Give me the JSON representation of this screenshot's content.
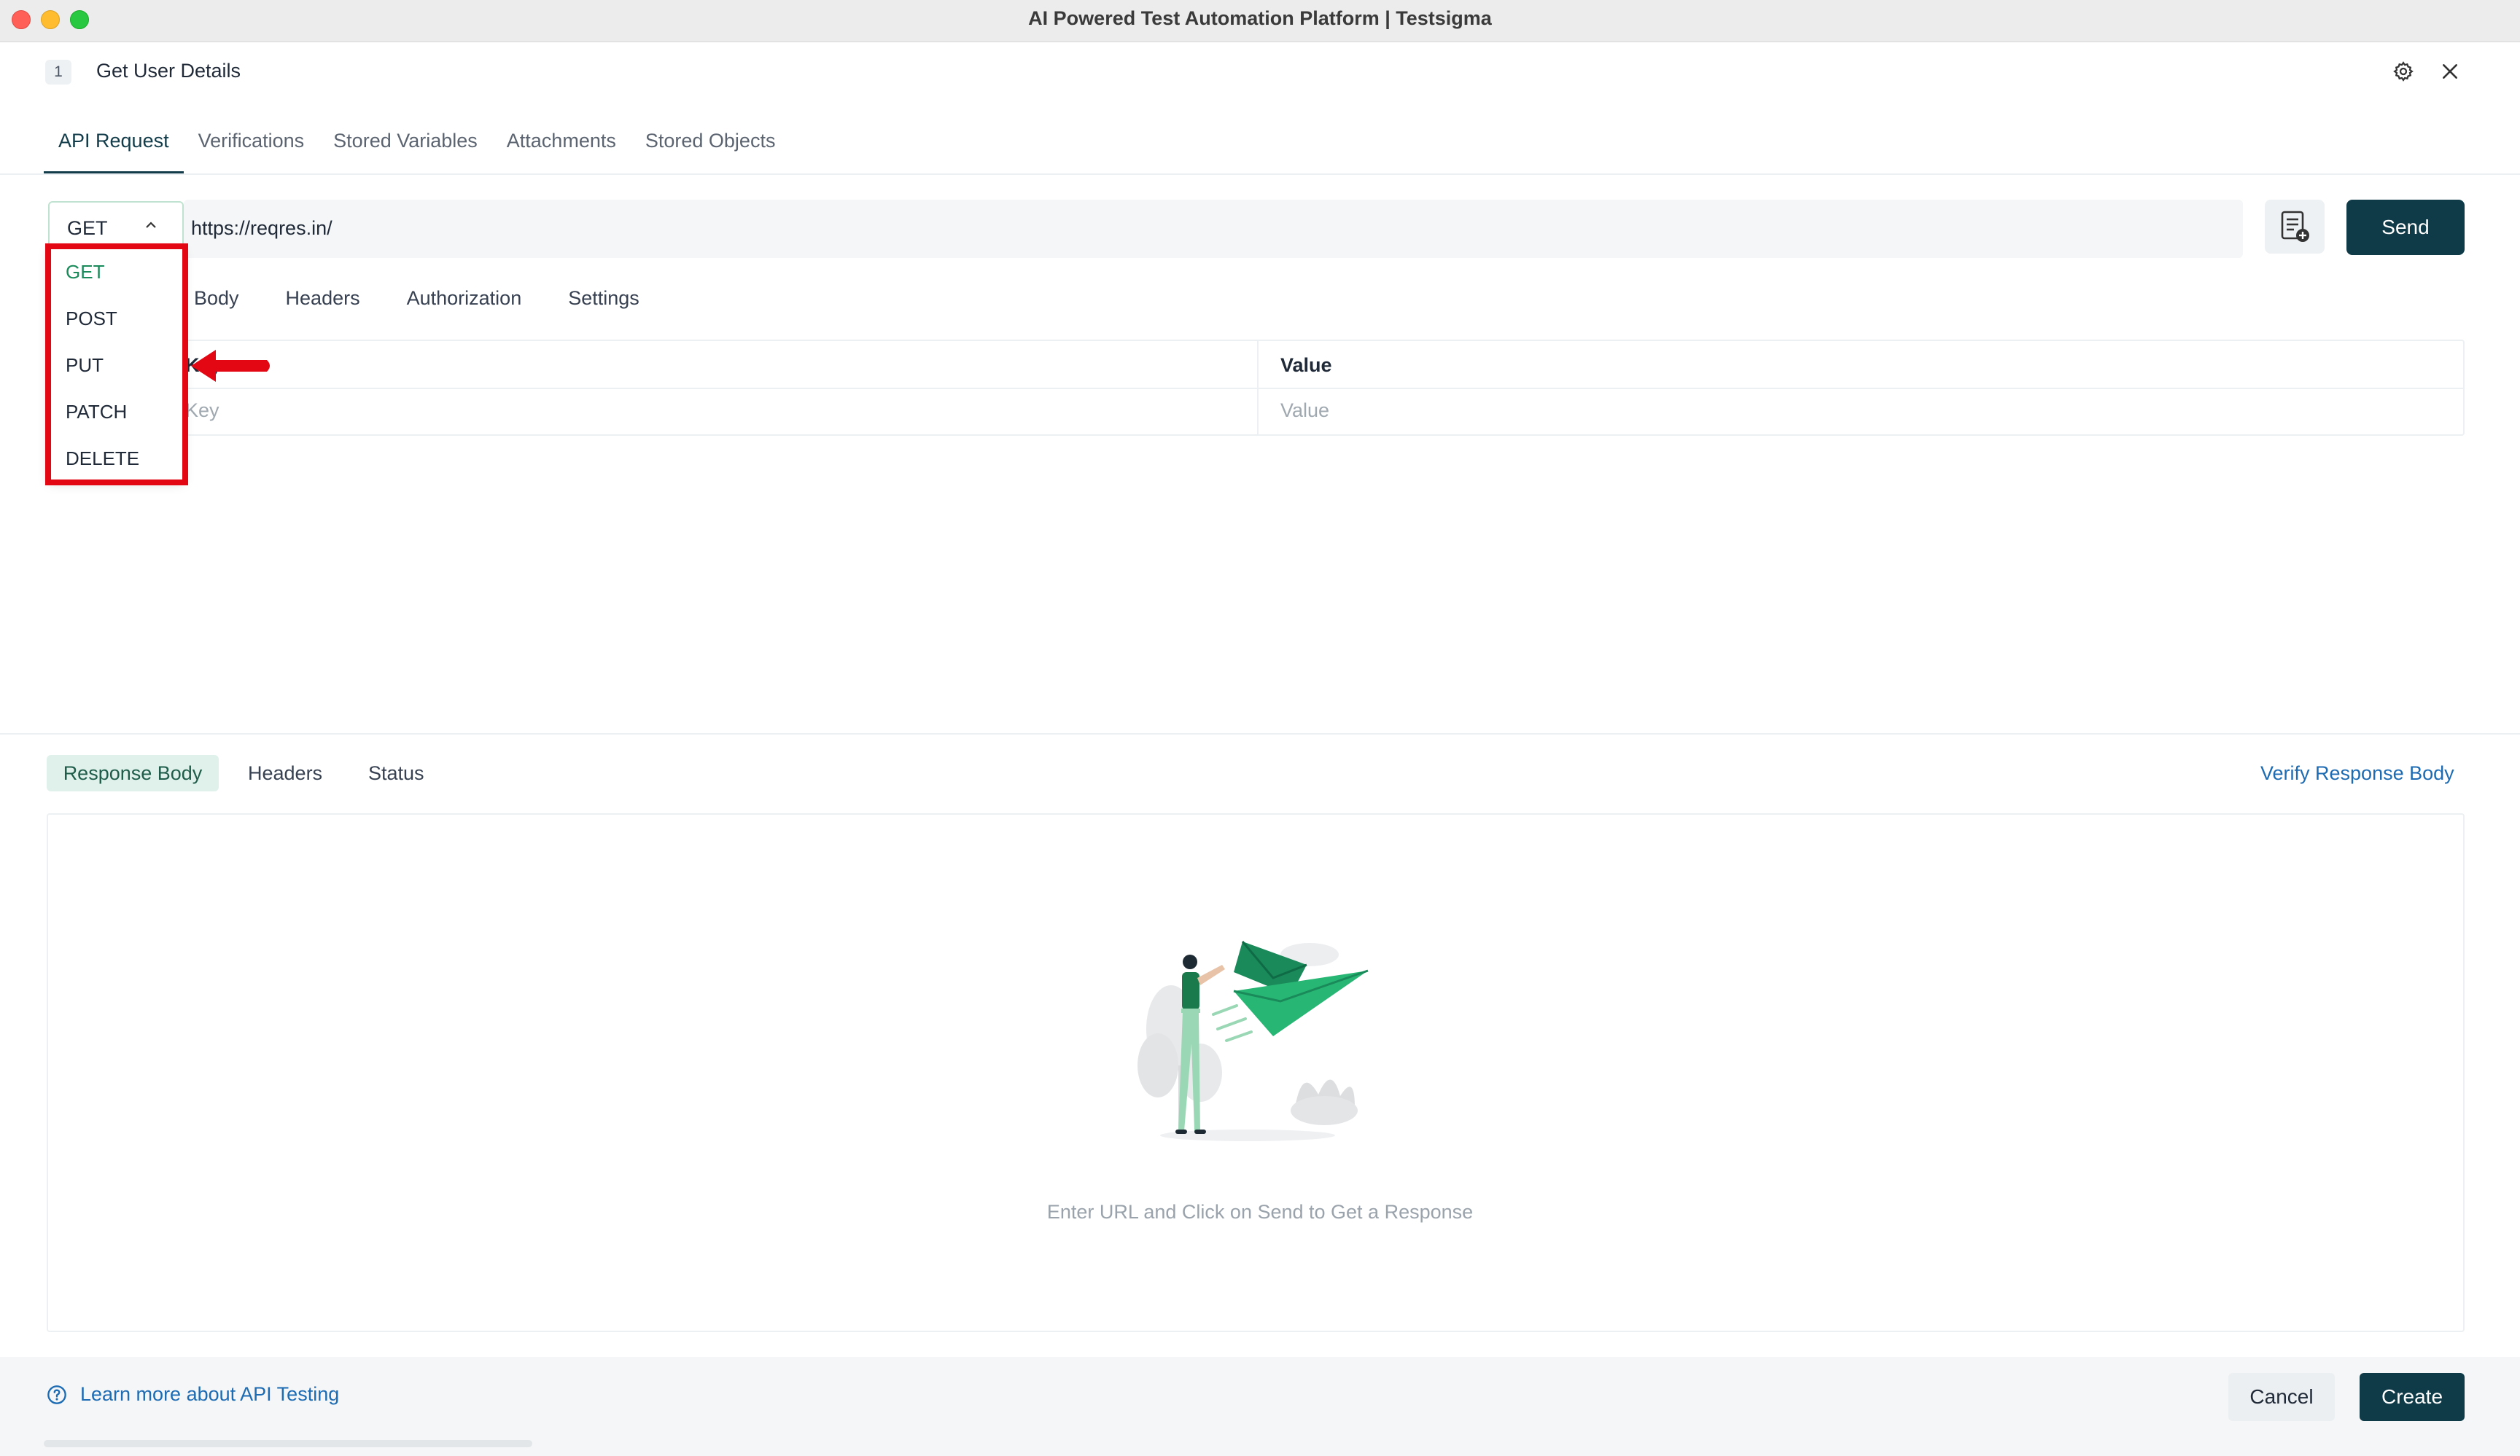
{
  "window": {
    "title": "AI Powered Test Automation Platform | Testsigma"
  },
  "header": {
    "step_number": "1",
    "step_name": "Get User Details",
    "settings_icon": "gear-icon",
    "close_icon": "close-icon"
  },
  "tabs_top": [
    {
      "label": "API Request",
      "active": true
    },
    {
      "label": "Verifications",
      "active": false
    },
    {
      "label": "Stored Variables",
      "active": false
    },
    {
      "label": "Attachments",
      "active": false
    },
    {
      "label": "Stored Objects",
      "active": false
    }
  ],
  "request": {
    "method": "GET",
    "url": "https://reqres.in/",
    "methods": [
      "GET",
      "POST",
      "PUT",
      "PATCH",
      "DELETE"
    ],
    "send_label": "Send",
    "add_icon": "document-add-icon"
  },
  "sub_tabs": [
    "Body",
    "Headers",
    "Authorization",
    "Settings"
  ],
  "params": {
    "key_header": "Key",
    "value_header": "Value",
    "key_placeholder": "Key",
    "value_placeholder": "Value"
  },
  "response": {
    "tabs": [
      "Response Body",
      "Headers",
      "Status"
    ],
    "active_tab": "Response Body",
    "verify_link": "Verify Response Body",
    "empty_message": "Enter URL and Click on Send to Get a Response"
  },
  "footer": {
    "learn_more": "Learn more about API Testing",
    "cancel_label": "Cancel",
    "create_label": "Create"
  },
  "colors": {
    "primary": "#0f3a47",
    "accent_green": "#1a8a5a",
    "highlight_red": "#e30613",
    "link_blue": "#1d6bb3"
  }
}
